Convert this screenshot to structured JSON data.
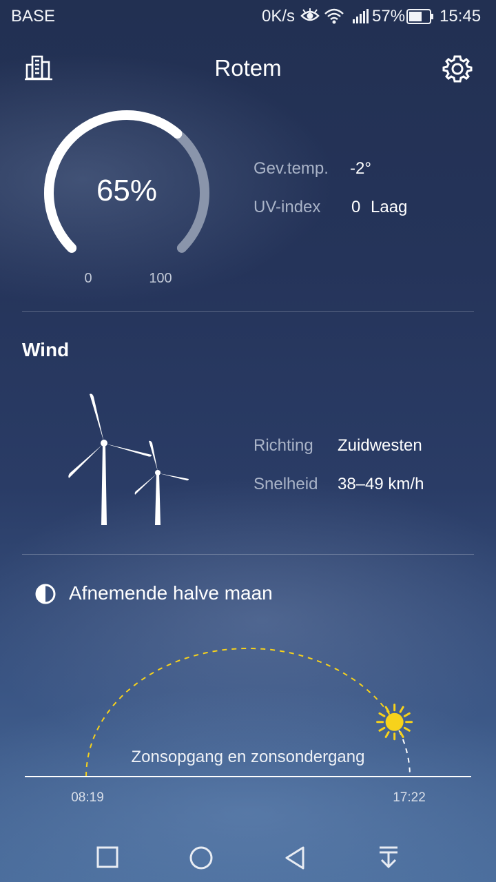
{
  "status_bar": {
    "carrier": "BASE",
    "net_speed": "0K/s",
    "battery_percent": "57%",
    "time": "15:45",
    "icons": [
      "eye-icon",
      "wifi-icon",
      "signal-icon",
      "battery-icon"
    ]
  },
  "header": {
    "city": "Rotem",
    "left_icon": "city-buildings-icon",
    "right_icon": "gear-icon"
  },
  "humidity": {
    "value_label": "65%",
    "value": 65,
    "min_label": "0",
    "max_label": "100"
  },
  "details": {
    "feels_like_label": "Gev.temp.",
    "feels_like_value": "-2°",
    "uv_label": "UV-index",
    "uv_value": "0",
    "uv_level": "Laag"
  },
  "wind": {
    "title": "Wind",
    "direction_label": "Richting",
    "direction_value": "Zuidwesten",
    "speed_label": "Snelheid",
    "speed_value": "38–49 km/h",
    "icon": "wind-turbines-icon"
  },
  "moon": {
    "phase": "Afnemende halve maan",
    "icon": "half-moon-icon"
  },
  "sun": {
    "caption": "Zonsopgang en zonsondergang",
    "sunrise": "08:19",
    "sunset": "17:22",
    "progress": 0.86,
    "icon": "sun-icon"
  },
  "colors": {
    "sun": "#f7d21b",
    "accent_white": "#ffffff",
    "muted": "#aab4c8"
  },
  "navbar": {
    "icons": [
      "square-recents-icon",
      "circle-home-icon",
      "triangle-back-icon",
      "pull-down-icon"
    ]
  }
}
